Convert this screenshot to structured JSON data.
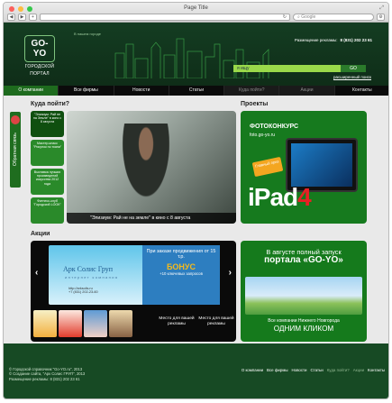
{
  "window": {
    "title": "Page Title",
    "resize_symbol": "⤢",
    "google_placeholder": "Google"
  },
  "header": {
    "logo_top": "GO-YO",
    "logo_line1": "ГОРОДСКОЙ",
    "logo_line2": "ПОРТАЛ",
    "note": "В нашем городе",
    "phone_label": "Размещение рекламы:",
    "phone_number": "8 (831) 202 23 61",
    "search_value": "я ищу",
    "search_button": "GO",
    "advanced_search": "расширенный поиск"
  },
  "menu": [
    "О компании",
    "Все фирмы",
    "Новости",
    "Статьи",
    "Куда пойти?",
    "Акции",
    "Контакты"
  ],
  "sidebar": {
    "feedback": "Обратная связь"
  },
  "where": {
    "heading": "Куда пойти?",
    "cards": [
      "\"Элизиум: Рай не на Земле\" в кино с 8 августа",
      "Мастер-класс \"Рисунок по ткани\"",
      "Выставка лучших произведений искусства 2012 года",
      "Фитнесс-клуб \"Городской LOOK\""
    ],
    "main_caption": "\"Элизиум: Рай не на земле\" в кино с 8 августа"
  },
  "projects": {
    "heading": "Проекты",
    "contest": "ФОТОКОНКУРС",
    "site": "foto.go-yo.ru",
    "prize": "Главный приз",
    "big_text": "iPad",
    "big_num": "4"
  },
  "promos": {
    "heading": "Акции",
    "company": "Арк Солис Груп",
    "company_sub": "интернет компания",
    "url": "http://arksolis.ru",
    "phone": "+7 (831) 202-23-60",
    "offer1": "При заказе продвижения от 15 т.р.",
    "bonus": "БОНУС",
    "offer2": "+10 ключевых запросов",
    "slot1": "Место для вашей рекламы",
    "slot2": "Место для вашей рекламы"
  },
  "portal": {
    "line1": "В августе полный запуск",
    "line2": "портала «GO-YO»",
    "line3": "Все компании Нижнего Новгорода",
    "line4": "ОДНИМ КЛИКОМ"
  },
  "footer": {
    "copy1": "© Городской справочник \"Go-YO.ru\", 2013",
    "copy2": "© Создание сайта, \"Арк Солис ГРУП\", 2013",
    "copy3": "Размещение рекламы: 8 (831) 202 23 61",
    "links": [
      "О компании",
      "Все фирмы",
      "Новости",
      "Статьи",
      "Куда пойти?",
      "Акции",
      "Контакты"
    ]
  },
  "colors": {
    "brand_green": "#167a1e",
    "dark_header": "#143d22",
    "accent_red": "#e92024",
    "bonus_yellow": "#f4ba1c"
  }
}
